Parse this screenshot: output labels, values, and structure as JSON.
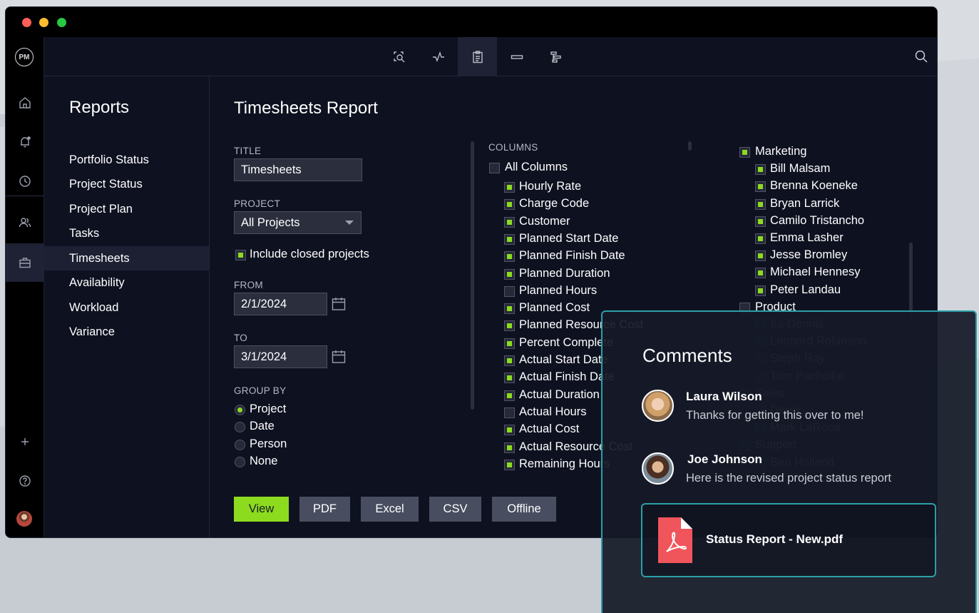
{
  "app": {
    "logo": "PM",
    "rail_icons": [
      "home-icon",
      "bell-icon",
      "clock-icon",
      "people-icon",
      "briefcase-icon",
      "plus-icon",
      "help-icon"
    ],
    "toolbar_icons": [
      "zoom-search-icon",
      "pulse-icon",
      "clipboard-icon",
      "card-icon",
      "gantt-icon"
    ],
    "search_icon": "search-icon",
    "accent_color": "#8cdb1f",
    "teal_color": "#2aa0a6"
  },
  "sidebar": {
    "title": "Reports",
    "items": [
      "Portfolio Status",
      "Project Status",
      "Project Plan",
      "Tasks",
      "Timesheets",
      "Availability",
      "Workload",
      "Variance"
    ],
    "active": "Timesheets"
  },
  "report": {
    "title": "Timesheets Report",
    "title_label": "TITLE",
    "title_value": "Timesheets",
    "project_label": "PROJECT",
    "project_value": "All Projects",
    "include_closed": "Include closed projects",
    "from_label": "FROM",
    "from_value": "2/1/2024",
    "to_label": "TO",
    "to_value": "3/1/2024",
    "group_by_label": "GROUP BY",
    "group_options": [
      "Project",
      "Date",
      "Person",
      "None"
    ],
    "group_selected": "Project"
  },
  "columns": {
    "label": "COLUMNS",
    "all_label": "All Columns",
    "items": [
      {
        "label": "Hourly Rate",
        "checked": true
      },
      {
        "label": "Charge Code",
        "checked": true
      },
      {
        "label": "Customer",
        "checked": true
      },
      {
        "label": "Planned Start Date",
        "checked": true
      },
      {
        "label": "Planned Finish Date",
        "checked": true
      },
      {
        "label": "Planned Duration",
        "checked": true
      },
      {
        "label": "Planned Hours",
        "checked": false
      },
      {
        "label": "Planned Cost",
        "checked": true
      },
      {
        "label": "Planned Resource Cost",
        "checked": true
      },
      {
        "label": "Percent Complete",
        "checked": true
      },
      {
        "label": "Actual Start Date",
        "checked": true
      },
      {
        "label": "Actual Finish Date",
        "checked": true
      },
      {
        "label": "Actual Duration",
        "checked": true
      },
      {
        "label": "Actual Hours",
        "checked": false
      },
      {
        "label": "Actual Cost",
        "checked": true
      },
      {
        "label": "Actual Resource Cost",
        "checked": true
      },
      {
        "label": "Remaining Hours",
        "checked": true
      }
    ]
  },
  "people": {
    "groups": [
      {
        "label": "Marketing",
        "checked": true,
        "members": [
          "Bill Malsam",
          "Brenna Koeneke",
          "Bryan Larrick",
          "Camilo Tristancho",
          "Emma Lasher",
          "Jesse Bromley",
          "Michael Hennesy",
          "Peter Landau"
        ]
      },
      {
        "label": "Product",
        "checked": false,
        "members": [
          "Ira Dennis",
          "Leonard Robinson",
          "Steph Ray",
          "Tom Pacholke"
        ]
      },
      {
        "label": "Sales",
        "checked": false,
        "members": [
          "Derek",
          "Mark LaRosa"
        ]
      },
      {
        "label": "Support",
        "checked": false,
        "members": [
          "Ben Holland"
        ]
      }
    ]
  },
  "buttons": {
    "view": "View",
    "pdf": "PDF",
    "excel": "Excel",
    "csv": "CSV",
    "offline": "Offline"
  },
  "comments": {
    "title": "Comments",
    "items": [
      {
        "name": "Laura Wilson",
        "text": "Thanks for getting this over to me!"
      },
      {
        "name": "Joe Johnson",
        "text": "Here is the revised project status report"
      }
    ],
    "attachment": "Status Report - New.pdf"
  }
}
